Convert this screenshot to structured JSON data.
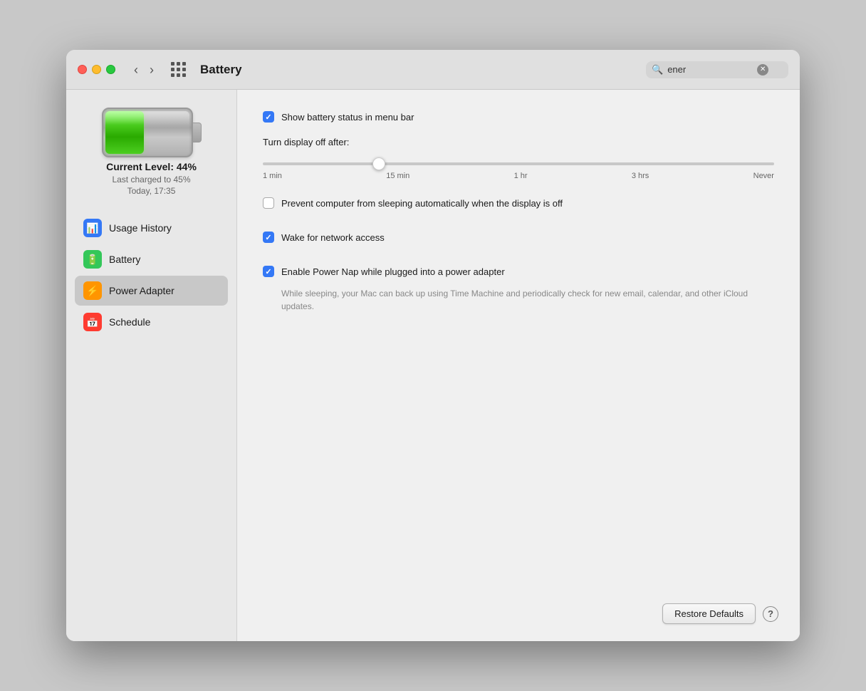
{
  "window": {
    "title": "Battery"
  },
  "titlebar": {
    "back_button": "‹",
    "forward_button": "›",
    "search_placeholder": "ener",
    "search_value": "ener"
  },
  "sidebar": {
    "battery_level": "Current Level: 44%",
    "last_charged": "Last charged to 45%",
    "last_time": "Today, 17:35",
    "nav_items": [
      {
        "id": "usage-history",
        "label": "Usage History",
        "icon": "📊",
        "icon_class": "icon-usage",
        "active": false
      },
      {
        "id": "battery",
        "label": "Battery",
        "icon": "🔋",
        "icon_class": "icon-battery",
        "active": false
      },
      {
        "id": "power-adapter",
        "label": "Power Adapter",
        "icon": "⚡",
        "icon_class": "icon-power",
        "active": true
      },
      {
        "id": "schedule",
        "label": "Schedule",
        "icon": "📅",
        "icon_class": "icon-schedule",
        "active": false
      }
    ]
  },
  "settings": {
    "show_battery_status": {
      "label": "Show battery status in menu bar",
      "checked": true
    },
    "display_off_label": "Turn display off after:",
    "slider": {
      "min": "1 min",
      "tick1": "15 min",
      "tick2": "1 hr",
      "tick3": "3 hrs",
      "max": "Never",
      "value": 22
    },
    "prevent_sleep": {
      "label": "Prevent computer from sleeping automatically when the display is off",
      "checked": false
    },
    "wake_network": {
      "label": "Wake for network access",
      "checked": true
    },
    "power_nap": {
      "label": "Enable Power Nap while plugged into a power adapter",
      "checked": true,
      "description": "While sleeping, your Mac can back up using Time Machine and periodically check for new email, calendar, and other iCloud updates."
    },
    "restore_button": "Restore Defaults",
    "help_button": "?"
  }
}
